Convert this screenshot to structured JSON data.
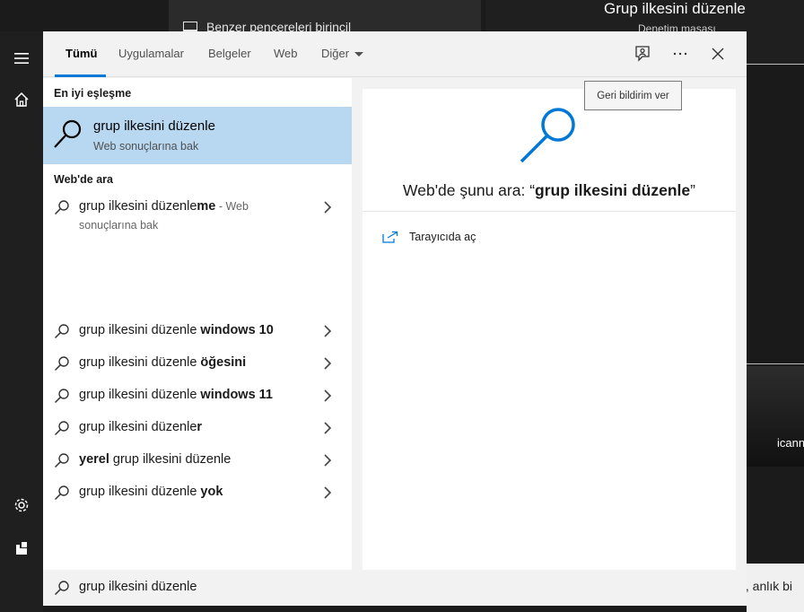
{
  "background": {
    "jumplist_item": "Benzer pencereleri birincil",
    "right_title": "Grup ilkesini düzenle",
    "right_subtitle": "Denetim masası",
    "side_text_1": "icann",
    "side_text_2": "al, anlık bi"
  },
  "rail": {
    "icons": [
      "hamburger-icon",
      "home-icon",
      "settings-icon",
      "user-icon"
    ]
  },
  "tabs": [
    {
      "label": "Tümü",
      "active": true
    },
    {
      "label": "Uygulamalar",
      "active": false
    },
    {
      "label": "Belgeler",
      "active": false
    },
    {
      "label": "Web",
      "active": false
    },
    {
      "label": "Diğer",
      "active": false
    }
  ],
  "topbar_icons": [
    "feedback-icon",
    "more-icon",
    "close-icon"
  ],
  "tooltip": "Geri bildirim ver",
  "best_match": {
    "heading": "En iyi eşleşme",
    "title": "grup ilkesini düzenle",
    "subtitle": "Web sonuçlarına bak"
  },
  "web_search": {
    "heading": "Web'de ara",
    "items": [
      {
        "pre": "grup ilkesini düzenle",
        "bold": "me",
        "post": "",
        "suffix": " - Web",
        "line2": "sonuçlarına bak"
      },
      {
        "pre": "grup ilkesini düzenle ",
        "bold": "windows 10",
        "post": ""
      },
      {
        "pre": "grup ilkesini düzenle ",
        "bold": "öğesini",
        "post": ""
      },
      {
        "pre": "grup ilkesini düzenle ",
        "bold": "windows 11",
        "post": ""
      },
      {
        "pre": "grup ilkesini düzenle",
        "bold": "r",
        "post": ""
      },
      {
        "pre": "",
        "bold": "yerel",
        "post": " grup ilkesini düzenle"
      },
      {
        "pre": "grup ilkesini düzenle ",
        "bold": "yok",
        "post": ""
      }
    ]
  },
  "preview": {
    "title_prefix": "Web'de şunu ara: “",
    "title_query": "grup ilkesini düzenle",
    "title_suffix": "”",
    "open_browser": "Tarayıcıda aç"
  },
  "searchbox": {
    "value": "grup ilkesini düzenle"
  },
  "colors": {
    "accent": "#0078d7",
    "selection": "#b8d8f2",
    "panel_bg": "#f2f2f2",
    "rail_bg": "#1f1f1f"
  }
}
